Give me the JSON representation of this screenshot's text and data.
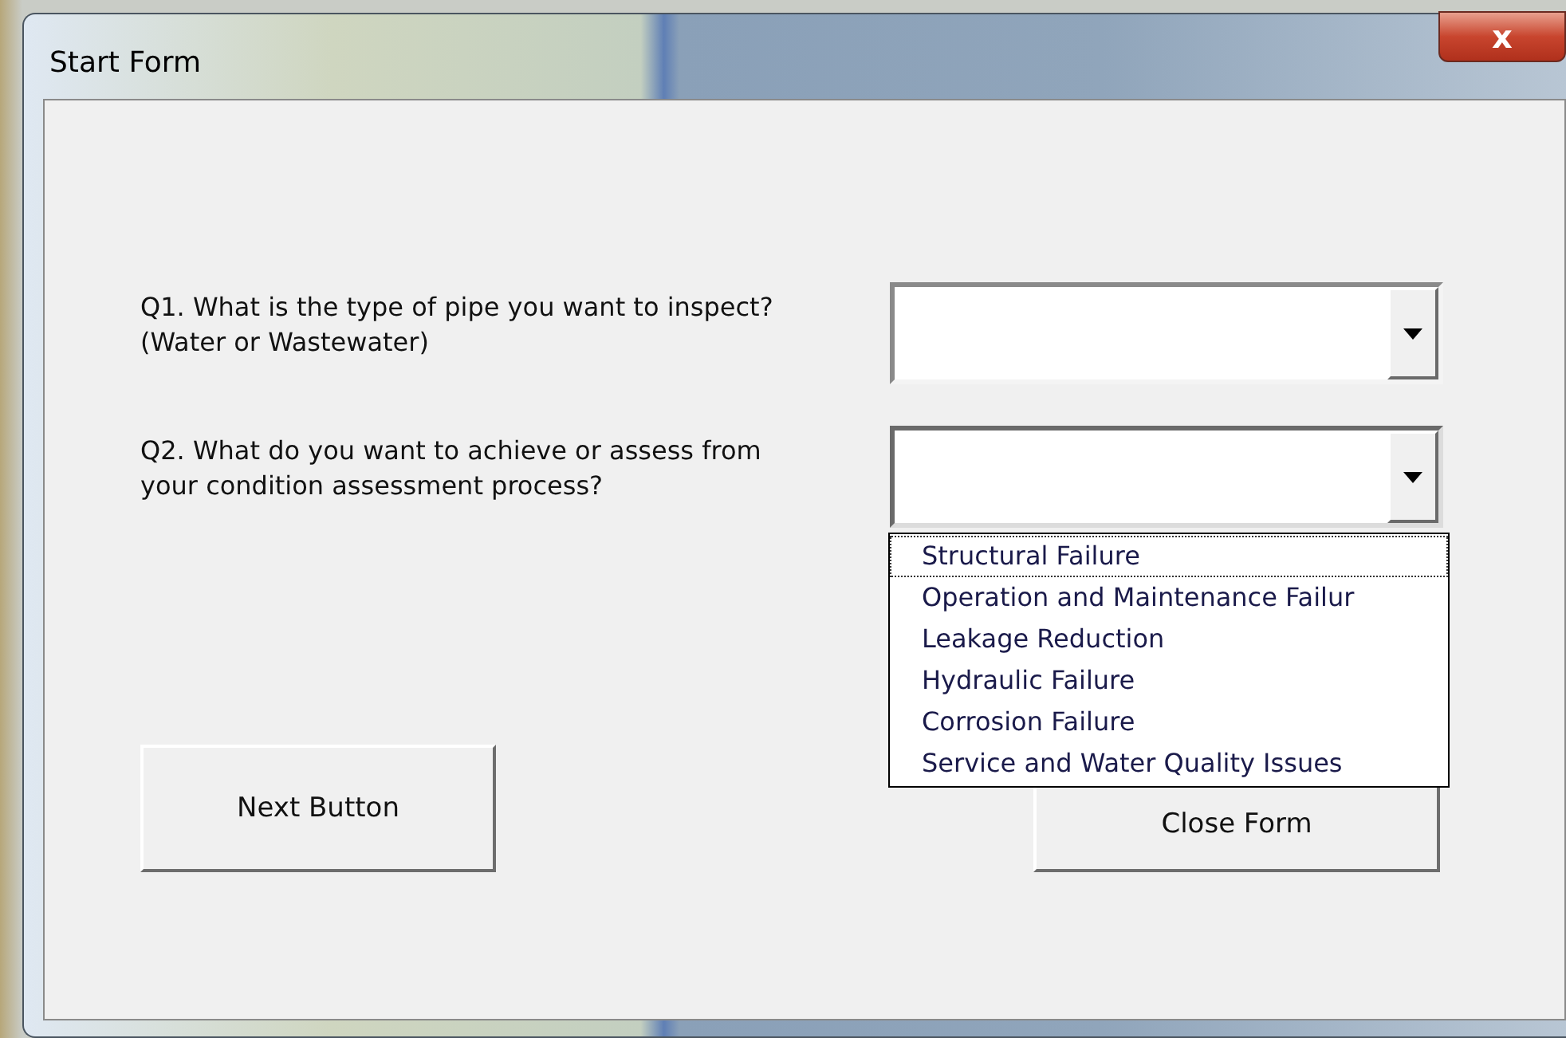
{
  "window": {
    "title": "Start Form",
    "close_button": "x"
  },
  "questions": [
    {
      "label": "Q1. What is the type of pipe you want to inspect? (Water or Wastewater)",
      "selected": false
    },
    {
      "label": "Q2. What do you want to achieve or assess from your condition assessment process?",
      "selected": true,
      "options": [
        {
          "label": "Structural Failure",
          "selected": true
        },
        {
          "label": "Operation and Maintenance Failur",
          "selected": false
        },
        {
          "label": "Leakage Reduction",
          "selected": false
        },
        {
          "label": "Hydraulic Failure",
          "selected": false
        },
        {
          "label": "Corrosion Failure",
          "selected": false
        },
        {
          "label": "Service and Water Quality Issues",
          "selected": false
        }
      ]
    }
  ],
  "buttons": [
    "Next Button",
    "Close Form"
  ]
}
